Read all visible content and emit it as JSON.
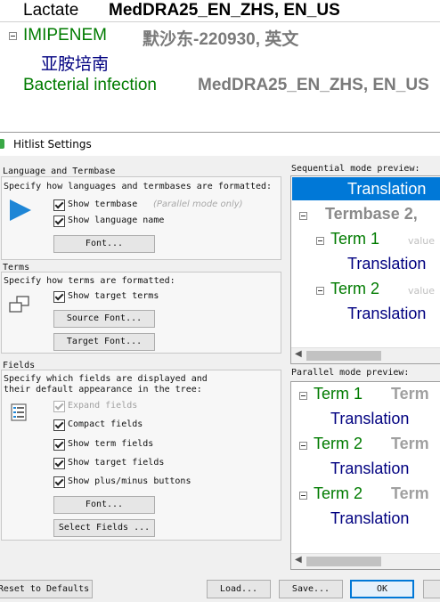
{
  "background": {
    "row1": {
      "label": "Lactate",
      "value": "MedDRA25_EN_ZHS, EN_US"
    },
    "row2": {
      "term": "IMIPENEM",
      "source": "默沙东-220930, 英文"
    },
    "row3": {
      "translation": "亚胺培南"
    },
    "row4": {
      "term": "Bacterial infection",
      "source": "MedDRA25_EN_ZHS, EN_US"
    }
  },
  "dialog": {
    "title": "Hitlist Settings",
    "language_section": {
      "heading": "Language and Termbase",
      "description": "Specify how languages and termbases are formatted:",
      "show_termbase": "Show termbase",
      "parallel_note": "(Parallel mode only)",
      "show_language_name": "Show language name",
      "font_button": "Font..."
    },
    "terms_section": {
      "heading": "Terms",
      "description": "Specify how terms are formatted:",
      "show_target_terms": "Show target terms",
      "source_font_button": "Source Font...",
      "target_font_button": "Target Font..."
    },
    "fields_section": {
      "heading": "Fields",
      "description": "Specify which fields are displayed and",
      "description2": "their default appearance in the tree:",
      "expand_fields": "Expand fields",
      "compact_fields": "Compact fields",
      "show_term_fields": "Show term fields",
      "show_target_fields": "Show target fields",
      "show_plus_minus": "Show plus/minus buttons",
      "font_button": "Font...",
      "select_fields_button": "Select Fields ..."
    },
    "sequential_preview": {
      "label": "Sequential mode preview:",
      "translation_selected": "Translation",
      "termbase": "Termbase 2,",
      "term1": "Term 1",
      "value_hint": "value",
      "translation1": "Translation",
      "term2": "Term 2",
      "translation2": "Translation"
    },
    "parallel_preview": {
      "label": "Parallel mode preview:",
      "term1": "Term 1",
      "term1_right": "Term",
      "translation1": "Translation",
      "term2a": "Term 2",
      "term2a_right": "Term",
      "translation2": "Translation",
      "term2b": "Term 2",
      "term2b_right": "Term",
      "translation3": "Translation"
    },
    "footer": {
      "reset_button": "Reset to Defaults",
      "load_button": "Load...",
      "save_button": "Save...",
      "ok_button": "OK"
    }
  },
  "colors": {
    "selection": "#0078d7",
    "navy": "#000080",
    "green": "#007b00"
  }
}
